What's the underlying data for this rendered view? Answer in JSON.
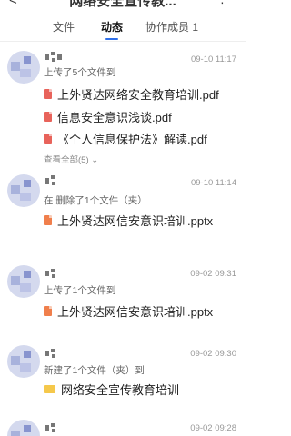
{
  "header": {
    "title": "网络安全宣传教...",
    "back_icon": "back-arrow-icon",
    "more_icon": "more-icon"
  },
  "tabs": [
    {
      "label": "文件"
    },
    {
      "label": "动态",
      "active": true
    },
    {
      "label": "协作成员 1"
    }
  ],
  "accent_color": "#2f6fe8",
  "feed": [
    {
      "time": "09-10 11:17",
      "action": "上传了5个文件到",
      "files": [
        {
          "name": "上外贤达网络安全教育培训.pdf",
          "type": "pdf"
        },
        {
          "name": "信息安全意识浅谈.pdf",
          "type": "pdf"
        },
        {
          "name": "《个人信息保护法》解读.pdf",
          "type": "pdf"
        }
      ],
      "see_all": "查看全部(5) ⌄"
    },
    {
      "time": "09-10 11:14",
      "action": "在  删除了1个文件（夹）",
      "files": [
        {
          "name": "上外贤达网信安意识培训.pptx",
          "type": "pptx"
        }
      ]
    },
    {
      "time": "09-02 09:31",
      "action": "上传了1个文件到",
      "files": [
        {
          "name": "上外贤达网信安意识培训.pptx",
          "type": "pptx"
        }
      ]
    },
    {
      "time": "09-02 09:30",
      "action": "新建了1个文件（夹）到",
      "files": [
        {
          "name": "网络安全宣传教育培训",
          "type": "folder"
        }
      ]
    },
    {
      "time": "09-02 09:28",
      "action": "",
      "files": []
    }
  ]
}
